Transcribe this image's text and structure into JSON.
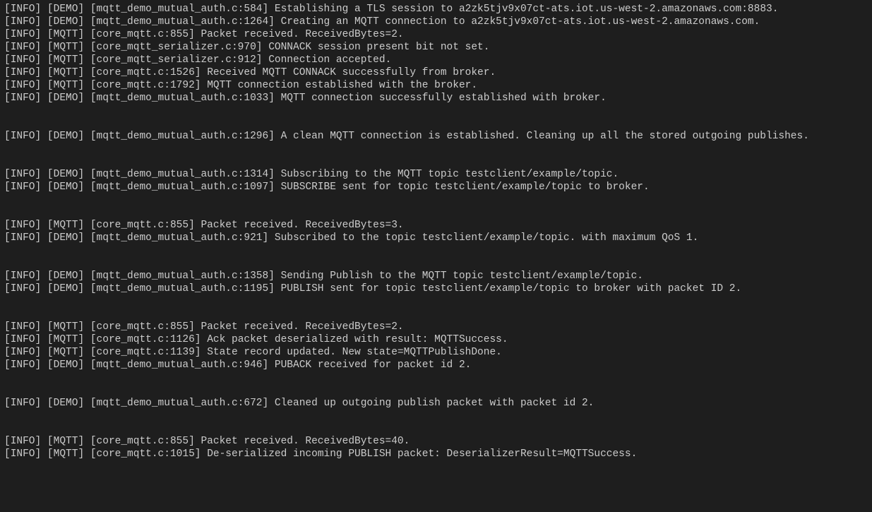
{
  "lines": [
    {
      "type": "log",
      "level": "INFO",
      "module": "DEMO",
      "source": "mqtt_demo_mutual_auth.c:584",
      "msg": "Establishing a TLS session to a2zk5tjv9x07ct-ats.iot.us-west-2.amazonaws.com:8883."
    },
    {
      "type": "log",
      "level": "INFO",
      "module": "DEMO",
      "source": "mqtt_demo_mutual_auth.c:1264",
      "msg": "Creating an MQTT connection to a2zk5tjv9x07ct-ats.iot.us-west-2.amazonaws.com."
    },
    {
      "type": "log",
      "level": "INFO",
      "module": "MQTT",
      "source": "core_mqtt.c:855",
      "msg": "Packet received. ReceivedBytes=2."
    },
    {
      "type": "log",
      "level": "INFO",
      "module": "MQTT",
      "source": "core_mqtt_serializer.c:970",
      "msg": "CONNACK session present bit not set."
    },
    {
      "type": "log",
      "level": "INFO",
      "module": "MQTT",
      "source": "core_mqtt_serializer.c:912",
      "msg": "Connection accepted."
    },
    {
      "type": "log",
      "level": "INFO",
      "module": "MQTT",
      "source": "core_mqtt.c:1526",
      "msg": "Received MQTT CONNACK successfully from broker."
    },
    {
      "type": "log",
      "level": "INFO",
      "module": "MQTT",
      "source": "core_mqtt.c:1792",
      "msg": "MQTT connection established with the broker."
    },
    {
      "type": "log",
      "level": "INFO",
      "module": "DEMO",
      "source": "mqtt_demo_mutual_auth.c:1033",
      "msg": "MQTT connection successfully established with broker."
    },
    {
      "type": "blank"
    },
    {
      "type": "blank"
    },
    {
      "type": "log",
      "level": "INFO",
      "module": "DEMO",
      "source": "mqtt_demo_mutual_auth.c:1296",
      "msg": "A clean MQTT connection is established. Cleaning up all the stored outgoing publishes."
    },
    {
      "type": "blank"
    },
    {
      "type": "blank"
    },
    {
      "type": "log",
      "level": "INFO",
      "module": "DEMO",
      "source": "mqtt_demo_mutual_auth.c:1314",
      "msg": "Subscribing to the MQTT topic testclient/example/topic."
    },
    {
      "type": "log",
      "level": "INFO",
      "module": "DEMO",
      "source": "mqtt_demo_mutual_auth.c:1097",
      "msg": "SUBSCRIBE sent for topic testclient/example/topic to broker."
    },
    {
      "type": "blank"
    },
    {
      "type": "blank"
    },
    {
      "type": "log",
      "level": "INFO",
      "module": "MQTT",
      "source": "core_mqtt.c:855",
      "msg": "Packet received. ReceivedBytes=3."
    },
    {
      "type": "log",
      "level": "INFO",
      "module": "DEMO",
      "source": "mqtt_demo_mutual_auth.c:921",
      "msg": "Subscribed to the topic testclient/example/topic. with maximum QoS 1."
    },
    {
      "type": "blank"
    },
    {
      "type": "blank"
    },
    {
      "type": "log",
      "level": "INFO",
      "module": "DEMO",
      "source": "mqtt_demo_mutual_auth.c:1358",
      "msg": "Sending Publish to the MQTT topic testclient/example/topic."
    },
    {
      "type": "log",
      "level": "INFO",
      "module": "DEMO",
      "source": "mqtt_demo_mutual_auth.c:1195",
      "msg": "PUBLISH sent for topic testclient/example/topic to broker with packet ID 2."
    },
    {
      "type": "blank"
    },
    {
      "type": "blank"
    },
    {
      "type": "log",
      "level": "INFO",
      "module": "MQTT",
      "source": "core_mqtt.c:855",
      "msg": "Packet received. ReceivedBytes=2."
    },
    {
      "type": "log",
      "level": "INFO",
      "module": "MQTT",
      "source": "core_mqtt.c:1126",
      "msg": "Ack packet deserialized with result: MQTTSuccess."
    },
    {
      "type": "log",
      "level": "INFO",
      "module": "MQTT",
      "source": "core_mqtt.c:1139",
      "msg": "State record updated. New state=MQTTPublishDone."
    },
    {
      "type": "log",
      "level": "INFO",
      "module": "DEMO",
      "source": "mqtt_demo_mutual_auth.c:946",
      "msg": "PUBACK received for packet id 2."
    },
    {
      "type": "blank"
    },
    {
      "type": "blank"
    },
    {
      "type": "log",
      "level": "INFO",
      "module": "DEMO",
      "source": "mqtt_demo_mutual_auth.c:672",
      "msg": "Cleaned up outgoing publish packet with packet id 2."
    },
    {
      "type": "blank"
    },
    {
      "type": "blank"
    },
    {
      "type": "log",
      "level": "INFO",
      "module": "MQTT",
      "source": "core_mqtt.c:855",
      "msg": "Packet received. ReceivedBytes=40."
    },
    {
      "type": "log",
      "level": "INFO",
      "module": "MQTT",
      "source": "core_mqtt.c:1015",
      "msg": "De-serialized incoming PUBLISH packet: DeserializerResult=MQTTSuccess."
    }
  ]
}
